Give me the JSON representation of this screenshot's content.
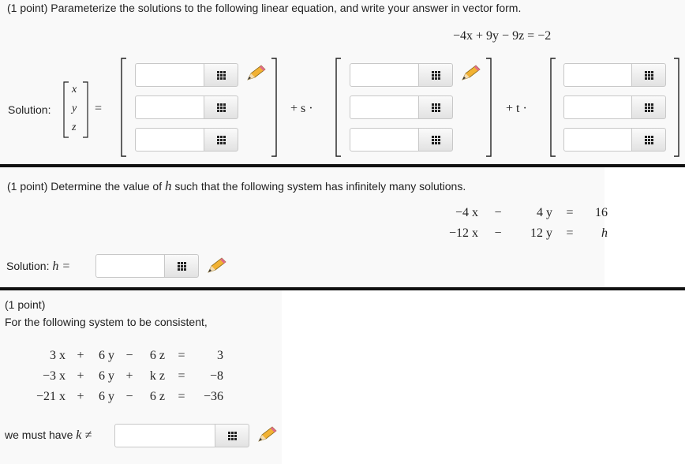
{
  "problem1": {
    "prompt": "(1 point) Parameterize the solutions to the following linear equation, and write your answer in vector form.",
    "equation": "−4x + 9y − 9z = −2",
    "solution_label": "Solution:",
    "vars": [
      "x",
      "y",
      "z"
    ],
    "equals": "=",
    "plus_s": "+ s ·",
    "plus_t": "+ t ·",
    "fields": [
      "",
      "",
      "",
      "",
      "",
      "",
      "",
      "",
      ""
    ]
  },
  "problem2": {
    "prompt_before": "(1 point) Determine the value of ",
    "prompt_var": "h",
    "prompt_after": " such that the following system has infinitely many solutions.",
    "rows": [
      {
        "a": "−4 x",
        "op": "−",
        "b": "4 y",
        "eq": "=",
        "rhs": "16"
      },
      {
        "a": "−12 x",
        "op": "−",
        "b": "12 y",
        "eq": "=",
        "rhs": "h"
      }
    ],
    "solution_label": "Solution:",
    "solution_var": "h =",
    "field": ""
  },
  "problem3": {
    "point": "(1 point)",
    "prompt": "For the following system to be consistent,",
    "rows": [
      {
        "a": "3 x",
        "op1": "+",
        "b": "6 y",
        "op2": "−",
        "c": "6 z",
        "eq": "=",
        "rhs": "3"
      },
      {
        "a": "−3 x",
        "op1": "+",
        "b": "6 y",
        "op2": "+",
        "c": "k z",
        "eq": "=",
        "rhs": "−8"
      },
      {
        "a": "−21 x",
        "op1": "+",
        "b": "6 y",
        "op2": "−",
        "c": "6 z",
        "eq": "=",
        "rhs": "−36"
      }
    ],
    "must_label": "we must have",
    "must_var": "k ≠",
    "field": ""
  },
  "icons": {
    "keypad": "keypad-icon",
    "pencil": "pencil-icon"
  },
  "colors": {
    "panel_bg": "#f9f9f9",
    "separator": "#111111",
    "pencil_body": "#f2b233"
  }
}
